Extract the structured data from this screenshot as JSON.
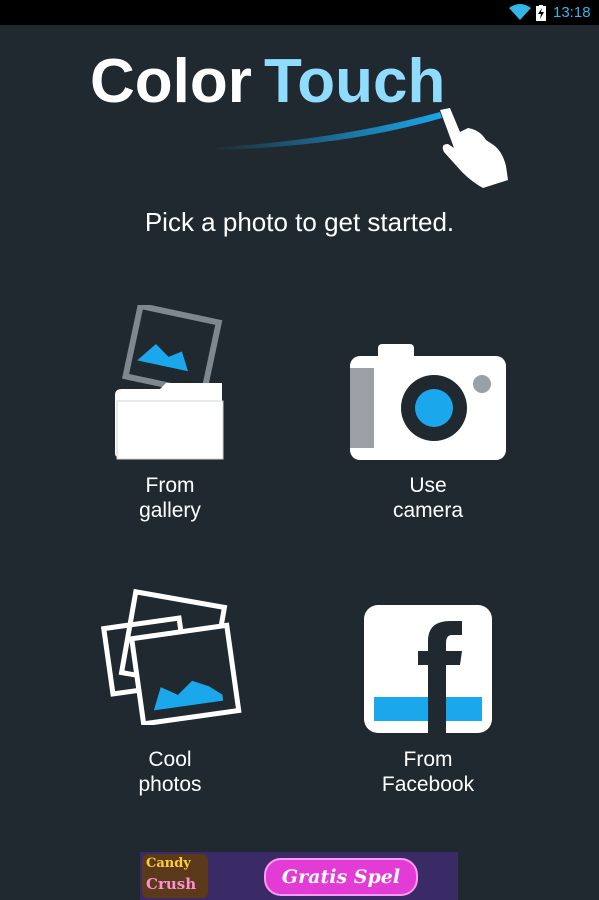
{
  "status_bar": {
    "time": "13:18",
    "icons": [
      "wifi-icon",
      "battery-charging-icon"
    ],
    "accent_color": "#33b5e5"
  },
  "app": {
    "logo_text_1": "Color",
    "logo_text_2": "Touch",
    "tagline": "Pick a photo to get started."
  },
  "tiles": [
    {
      "icon": "gallery-folder-icon",
      "label_line1": "From",
      "label_line2": "gallery"
    },
    {
      "icon": "camera-icon",
      "label_line1": "Use",
      "label_line2": "camera"
    },
    {
      "icon": "cool-photos-icon",
      "label_line1": "Cool",
      "label_line2": "photos"
    },
    {
      "icon": "facebook-icon",
      "label_line1": "From",
      "label_line2": "Facebook"
    }
  ],
  "ad": {
    "logo_line1": "Candy",
    "logo_line2": "Crush",
    "cta": "Gratis Spel"
  },
  "colors": {
    "background": "#1f292f",
    "accent": "#1aa7ec"
  }
}
